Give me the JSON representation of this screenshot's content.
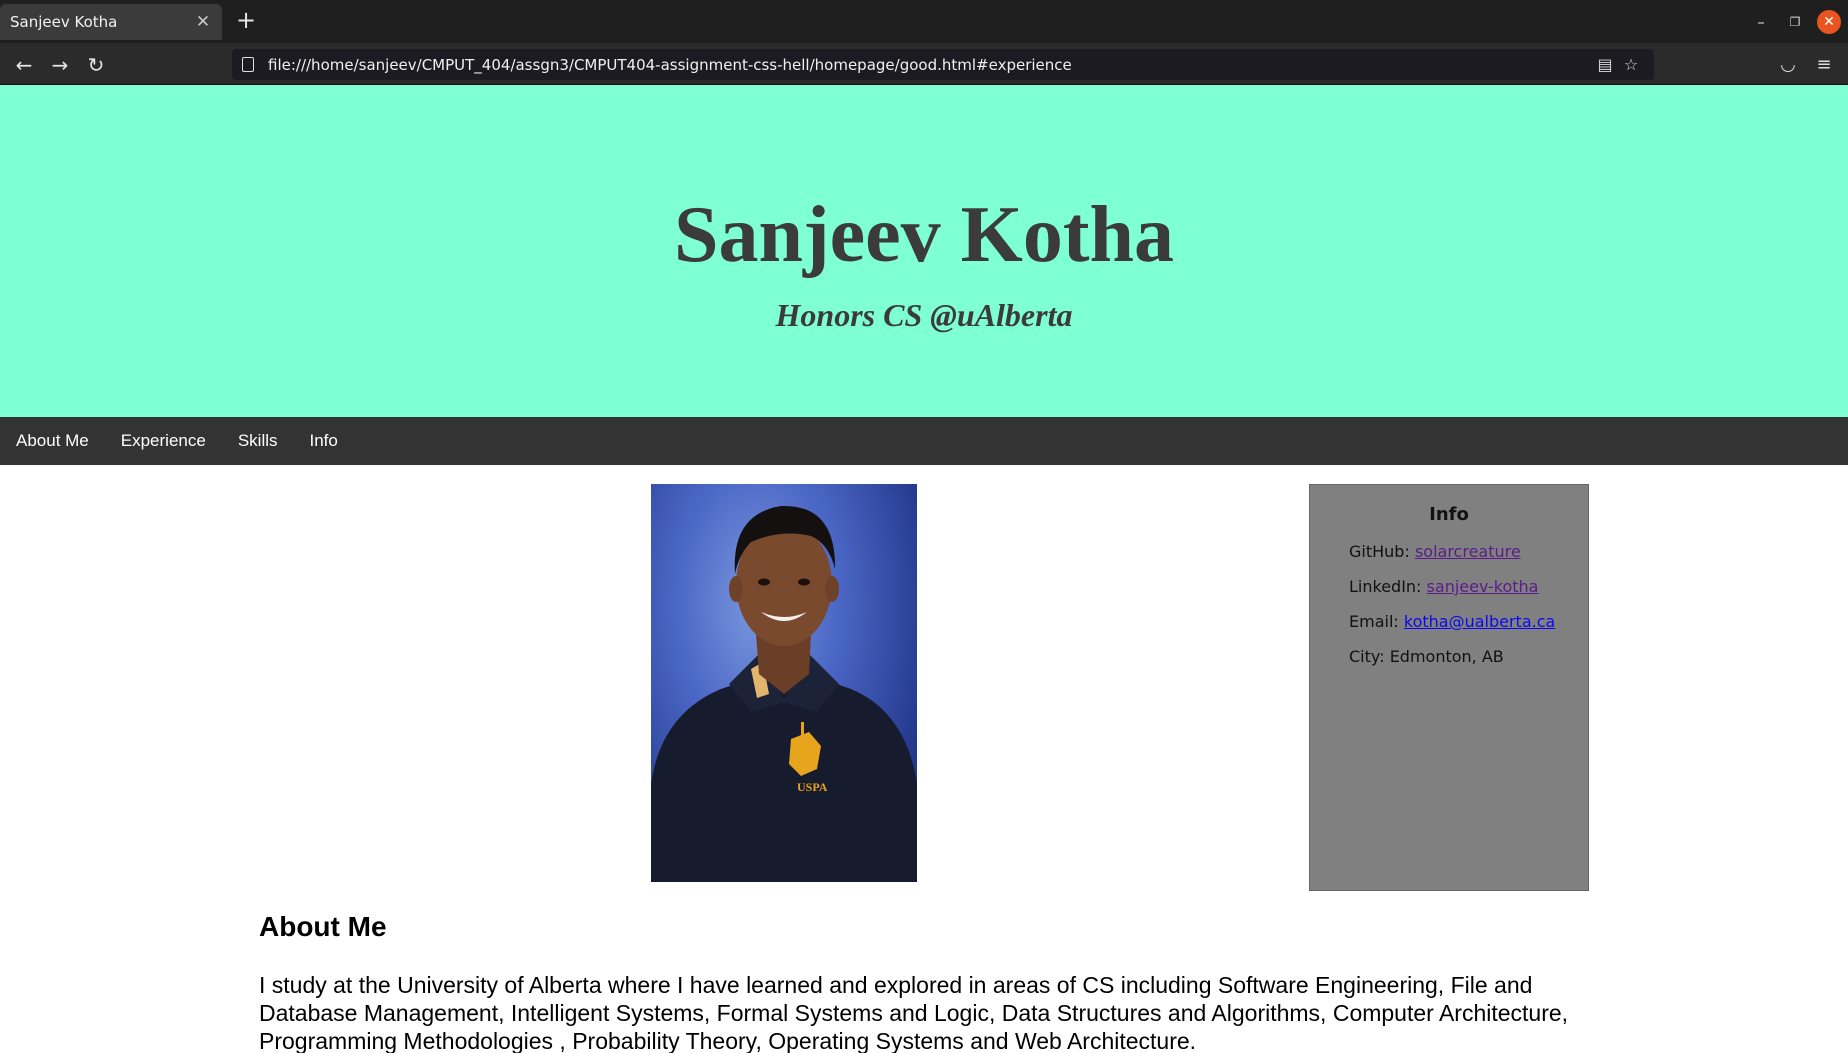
{
  "browser": {
    "tab_title": "Sanjeev Kotha",
    "url": "file:///home/sanjeev/CMPUT_404/assgn3/CMPUT404-assignment-css-hell/homepage/good.html#experience"
  },
  "hero": {
    "name": "Sanjeev Kotha",
    "subtitle": "Honors CS @uAlberta",
    "background_color": "#7fffd4"
  },
  "nav": {
    "items": [
      "About Me",
      "Experience",
      "Skills",
      "Info"
    ]
  },
  "info": {
    "title": "Info",
    "github_label": "GitHub:",
    "github_link": "solarcreature",
    "linkedin_label": "LinkedIn:",
    "linkedin_link": "sanjeev-kotha",
    "email_label": "Email:",
    "email_link": "kotha@ualberta.ca",
    "city_label": "City:",
    "city_value": "Edmonton, AB"
  },
  "about": {
    "heading": "About Me",
    "text": "I study at the University of Alberta where I have learned and explored in areas of CS including Software Engineering, File and Database Management, Intelligent Systems, Formal Systems and Logic, Data Structures and Algorithms, Computer Architecture, Programming Methodologies , Probability Theory, Operating Systems and Web Architecture."
  },
  "photo": {
    "logo_text": "USPA"
  },
  "icons": {
    "back": "arrow-left-icon",
    "forward": "arrow-right-icon",
    "reload": "reload-icon",
    "reader": "reader-view-icon",
    "bookmark": "star-icon",
    "pocket": "pocket-icon",
    "menu": "hamburger-menu-icon"
  }
}
